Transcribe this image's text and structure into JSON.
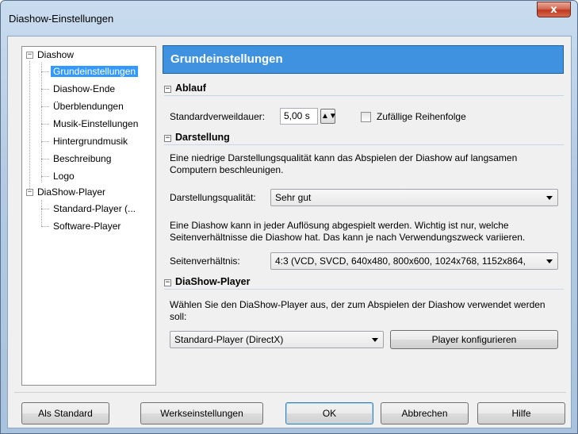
{
  "window": {
    "title": "Diashow-Einstellungen",
    "close_glyph": "x"
  },
  "tree": {
    "groups": [
      {
        "label": "Diashow",
        "expander": "−"
      },
      {
        "label": "DiaShow-Player",
        "expander": "−"
      }
    ],
    "items": [
      "Grundeinstellungen",
      "Diashow-Ende",
      "Überblendungen",
      "Musik-Einstellungen",
      "Hintergrundmusik",
      "Beschreibung",
      "Logo",
      "Standard-Player (...",
      "Software-Player"
    ],
    "selected": "Grundeinstellungen"
  },
  "panel": {
    "title": "Grundeinstellungen",
    "sections": {
      "ablauf": {
        "title": "Ablauf",
        "dwell_label": "Standardverweildauer:",
        "dwell_value": "5,00 s",
        "random_label": "Zufällige Reihenfolge",
        "random_checked": false
      },
      "darstellung": {
        "title": "Darstellung",
        "info1": "Eine niedrige Darstellungsqualität kann das Abspielen der Diashow auf langsamen Computern beschleunigen.",
        "quality_label": "Darstellungsqualität:",
        "quality_value": "Sehr gut",
        "info2": "Eine Diashow kann in jeder Auflösung abgespielt werden. Wichtig ist nur, welche Seitenverhältnisse die Diashow hat. Das kann je nach Verwendungszweck variieren.",
        "ratio_label": "Seitenverhältnis:",
        "ratio_value": "4:3 (VCD, SVCD, 640x480, 800x600, 1024x768, 1152x864,"
      },
      "player": {
        "title": "DiaShow-Player",
        "info": "Wählen Sie den DiaShow-Player aus, der zum Abspielen der Diashow verwendet werden soll:",
        "player_value": "Standard-Player (DirectX)",
        "configure_label": "Player konfigurieren"
      }
    }
  },
  "footer": {
    "default_label": "Als Standard",
    "factory_label": "Werkseinstellungen",
    "ok_label": "OK",
    "cancel_label": "Abbrechen",
    "help_label": "Hilfe"
  },
  "colors": {
    "header_bg": "#3e92e0",
    "selection": "#3399ff",
    "close_button": "#c0391f"
  }
}
